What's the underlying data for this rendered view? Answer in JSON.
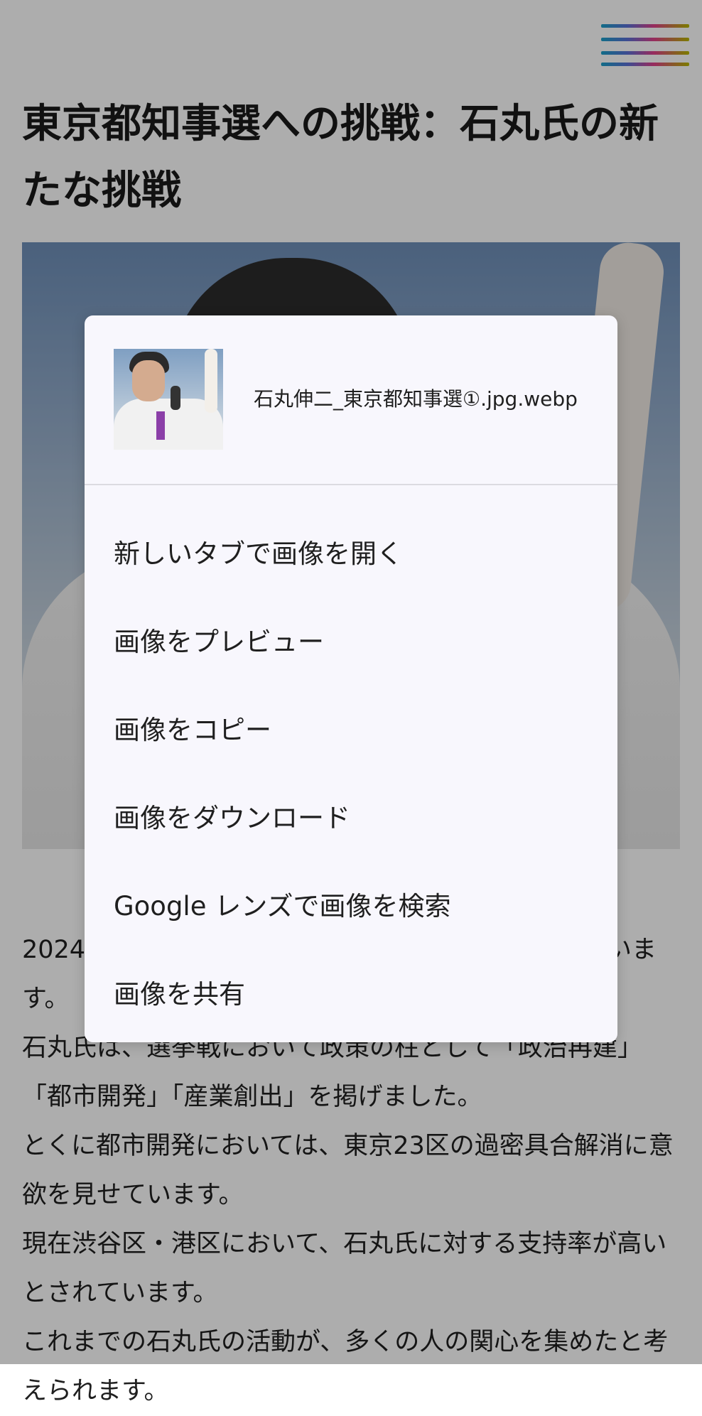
{
  "header": {
    "menu_icon": "hamburger-menu-icon"
  },
  "article": {
    "title": "東京都知事選への挑戦：石丸氏の新たな挑戦",
    "paragraphs": [
      "2024年の東京都知事選に立候補することを表明しています。",
      "石丸氏は、選挙戦において政策の柱として「政治再建」「都市開発」「産業創出」を掲げました。",
      "とくに都市開発においては、東京23区の過密具合解消に意欲を見せています。",
      "現在渋谷区・港区において、石丸氏に対する支持率が高いとされています。",
      "これまでの石丸氏の活動が、多くの人の関心を集めたと考えられます。"
    ]
  },
  "context_menu": {
    "filename": "石丸伸二_東京都知事選①.jpg.webp",
    "items": [
      {
        "label": "新しいタブで画像を開く"
      },
      {
        "label": "画像をプレビュー"
      },
      {
        "label": "画像をコピー"
      },
      {
        "label": "画像をダウンロード"
      },
      {
        "label": "Google レンズで画像を検索"
      },
      {
        "label": "画像を共有"
      }
    ]
  },
  "colors": {
    "scrim": "#000000",
    "dialog_background": "#f8f7fd",
    "text": "#1f1f1f"
  }
}
